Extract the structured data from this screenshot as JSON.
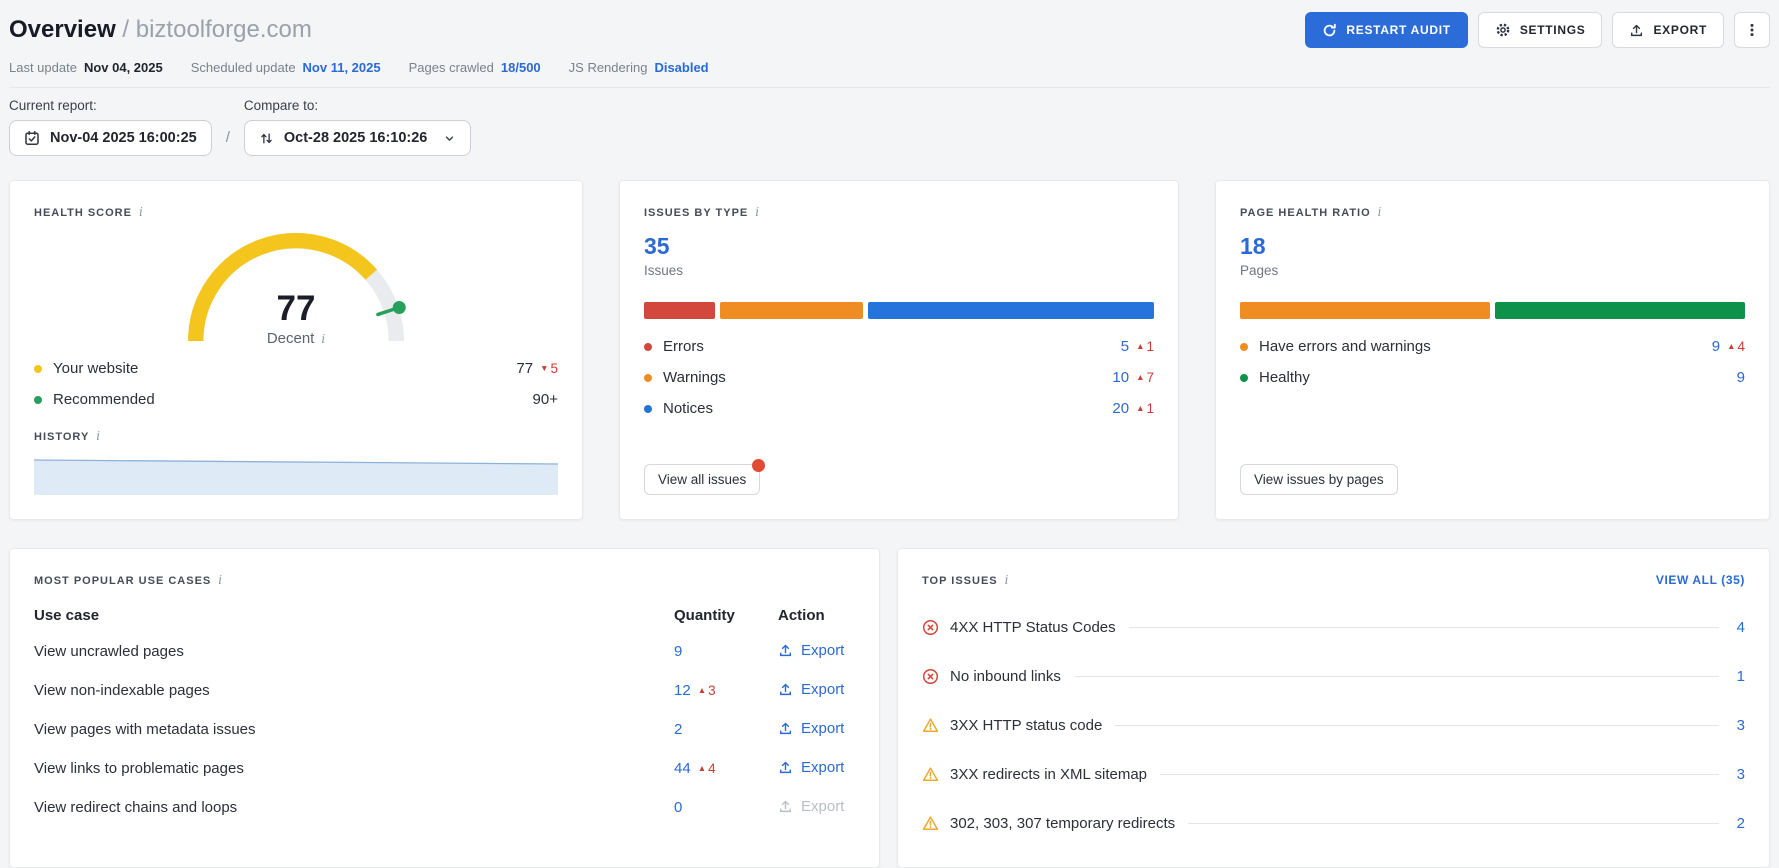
{
  "header": {
    "title": "Overview",
    "separator": "/",
    "domain": "biztoolforge.com",
    "buttons": {
      "restart": "RESTART AUDIT",
      "settings": "SETTINGS",
      "export": "EXPORT"
    },
    "meta": [
      {
        "label": "Last update",
        "value": "Nov 04, 2025",
        "style": "dark"
      },
      {
        "label": "Scheduled update",
        "value": "Nov 11, 2025",
        "style": "link"
      },
      {
        "label": "Pages crawled",
        "value": "18/500",
        "style": "link"
      },
      {
        "label": "JS Rendering",
        "value": "Disabled",
        "style": "link"
      }
    ]
  },
  "report_bar": {
    "current_label": "Current report:",
    "current_value": "Nov-04 2025 16:00:25",
    "separator": "/",
    "compare_label": "Compare to:",
    "compare_value": "Oct-28 2025 16:10:26"
  },
  "health_score": {
    "title": "HEALTH SCORE",
    "score": "77",
    "rating": "Decent",
    "gauge": {
      "value": 77,
      "max": 100,
      "marker": 90,
      "arc_color": "#f4c51c",
      "track_color": "#e9ebee",
      "marker_color": "#27a05c"
    },
    "legend": [
      {
        "label": "Your website",
        "color": "#f4c51c",
        "value": "77",
        "delta": "5",
        "delta_dir": "down"
      },
      {
        "label": "Recommended",
        "color": "#27a05c",
        "value": "90+"
      }
    ],
    "history_title": "HISTORY",
    "history": {
      "fill": "#dfeaf7",
      "line": "#8cb2da"
    }
  },
  "issues_by_type": {
    "title": "ISSUES BY TYPE",
    "total": "35",
    "total_label": "Issues",
    "rows": [
      {
        "label": "Errors",
        "color": "#d3483c",
        "value": 5,
        "delta": "1",
        "delta_dir": "up"
      },
      {
        "label": "Warnings",
        "color": "#ef8d22",
        "value": 10,
        "delta": "7",
        "delta_dir": "up"
      },
      {
        "label": "Notices",
        "color": "#2574db",
        "value": 20,
        "delta": "1",
        "delta_dir": "up"
      }
    ],
    "button": "View all issues",
    "has_notification": true
  },
  "page_health_ratio": {
    "title": "PAGE HEALTH RATIO",
    "total": "18",
    "total_label": "Pages",
    "rows": [
      {
        "label": "Have errors and warnings",
        "color": "#ef8d22",
        "value": 9,
        "delta": "4",
        "delta_dir": "up"
      },
      {
        "label": "Healthy",
        "color": "#0e9249",
        "value": 9
      }
    ],
    "button": "View issues by pages"
  },
  "use_cases": {
    "title": "MOST POPULAR USE CASES",
    "columns": [
      "Use case",
      "Quantity",
      "Action"
    ],
    "export_label": "Export",
    "rows": [
      {
        "label": "View uncrawled pages",
        "quantity": "9"
      },
      {
        "label": "View non-indexable pages",
        "quantity": "12",
        "delta": "3",
        "delta_dir": "up"
      },
      {
        "label": "View pages with metadata issues",
        "quantity": "2"
      },
      {
        "label": "View links to problematic pages",
        "quantity": "44",
        "delta": "4",
        "delta_dir": "up"
      },
      {
        "label": "View redirect chains and loops",
        "quantity": "0",
        "disabled": true
      }
    ]
  },
  "top_issues": {
    "title": "TOP ISSUES",
    "view_all": "VIEW ALL (35)",
    "rows": [
      {
        "label": "4XX HTTP Status Codes",
        "severity": "error",
        "count": "4"
      },
      {
        "label": "No inbound links",
        "severity": "error",
        "count": "1"
      },
      {
        "label": "3XX HTTP status code",
        "severity": "warning",
        "count": "3"
      },
      {
        "label": "3XX redirects in XML sitemap",
        "severity": "warning",
        "count": "3"
      },
      {
        "label": "302, 303, 307 temporary redirects",
        "severity": "warning",
        "count": "2"
      }
    ]
  },
  "colors": {
    "link": "#2a6ad4",
    "delta_red": "#ca3d33",
    "error": "#d3483c",
    "warning": "#ecaa2b",
    "success": "#0e9249",
    "primary_button": "#2b6cd9"
  }
}
